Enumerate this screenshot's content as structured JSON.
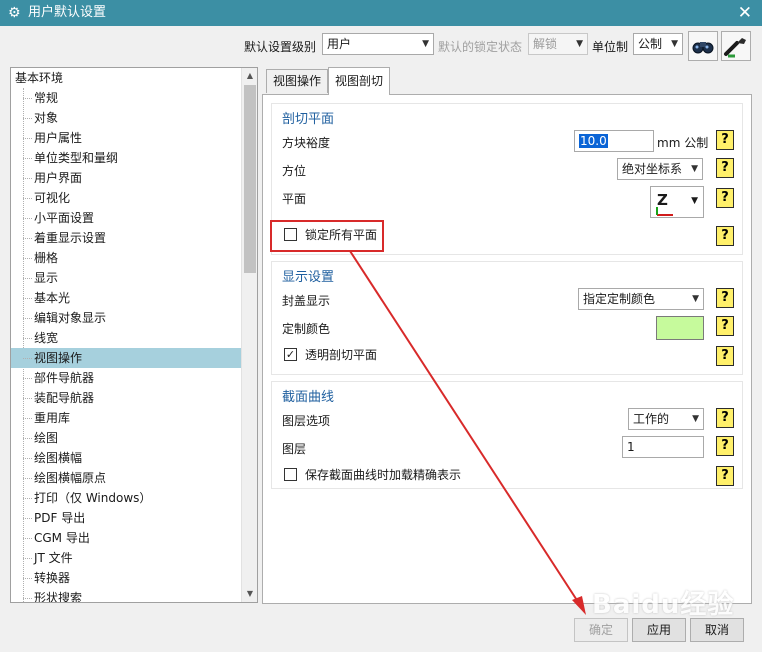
{
  "titlebar": {
    "icon": "gear-icon",
    "title": "用户默认设置",
    "close": "✕"
  },
  "toolbar": {
    "level_label": "默认设置级别",
    "level_value": "用户",
    "lock_label": "默认的锁定状态",
    "lock_value": "解锁",
    "unit_label": "单位制",
    "unit_value": "公制"
  },
  "tree": {
    "items": [
      {
        "label": "基本环境",
        "root": true
      },
      {
        "label": "常规"
      },
      {
        "label": "对象"
      },
      {
        "label": "用户属性"
      },
      {
        "label": "单位类型和量纲"
      },
      {
        "label": "用户界面"
      },
      {
        "label": "可视化"
      },
      {
        "label": "小平面设置"
      },
      {
        "label": "着重显示设置"
      },
      {
        "label": "栅格"
      },
      {
        "label": "显示"
      },
      {
        "label": "基本光"
      },
      {
        "label": "编辑对象显示"
      },
      {
        "label": "线宽"
      },
      {
        "label": "视图操作",
        "selected": true
      },
      {
        "label": "部件导航器"
      },
      {
        "label": "装配导航器"
      },
      {
        "label": "重用库"
      },
      {
        "label": "绘图"
      },
      {
        "label": "绘图横幅"
      },
      {
        "label": "绘图横幅原点"
      },
      {
        "label": "打印（仅 Windows）"
      },
      {
        "label": "PDF 导出"
      },
      {
        "label": "CGM 导出"
      },
      {
        "label": "JT 文件"
      },
      {
        "label": "转换器"
      },
      {
        "label": "形状搜索"
      }
    ]
  },
  "tabs": [
    {
      "label": "视图操作",
      "active": false
    },
    {
      "label": "视图剖切",
      "active": true
    }
  ],
  "section_cut": {
    "header": "剖切平面",
    "block_margin_label": "方块裕度",
    "block_margin_value": "10.0",
    "block_margin_unit": "mm 公制",
    "orientation_label": "方位",
    "orientation_value": "绝对坐标系",
    "plane_label": "平面",
    "plane_icon": "Z",
    "lock_all_planes_label": "锁定所有平面",
    "lock_all_planes_checked": false
  },
  "display_settings": {
    "header": "显示设置",
    "cap_display_label": "封盖显示",
    "cap_display_value": "指定定制颜色",
    "custom_color_label": "定制颜色",
    "custom_color": "#c6fa9c",
    "transparent_label": "透明剖切平面",
    "transparent_checked": true
  },
  "section_curves": {
    "header": "截面曲线",
    "layer_option_label": "图层选项",
    "layer_option_value": "工作的",
    "layer_label": "图层",
    "layer_value": "1",
    "save_exact_label": "保存截面曲线时加载精确表示",
    "save_exact_checked": false
  },
  "help_glyph": "?",
  "buttons": {
    "ok": "确定",
    "apply": "应用",
    "cancel": "取消"
  },
  "watermark": "Baidu经验",
  "colors": {
    "title_bar": "#3c8fa4",
    "selection": "#a6d0dd",
    "annotation": "#d82a2a",
    "group_header": "#1f5f9f"
  }
}
